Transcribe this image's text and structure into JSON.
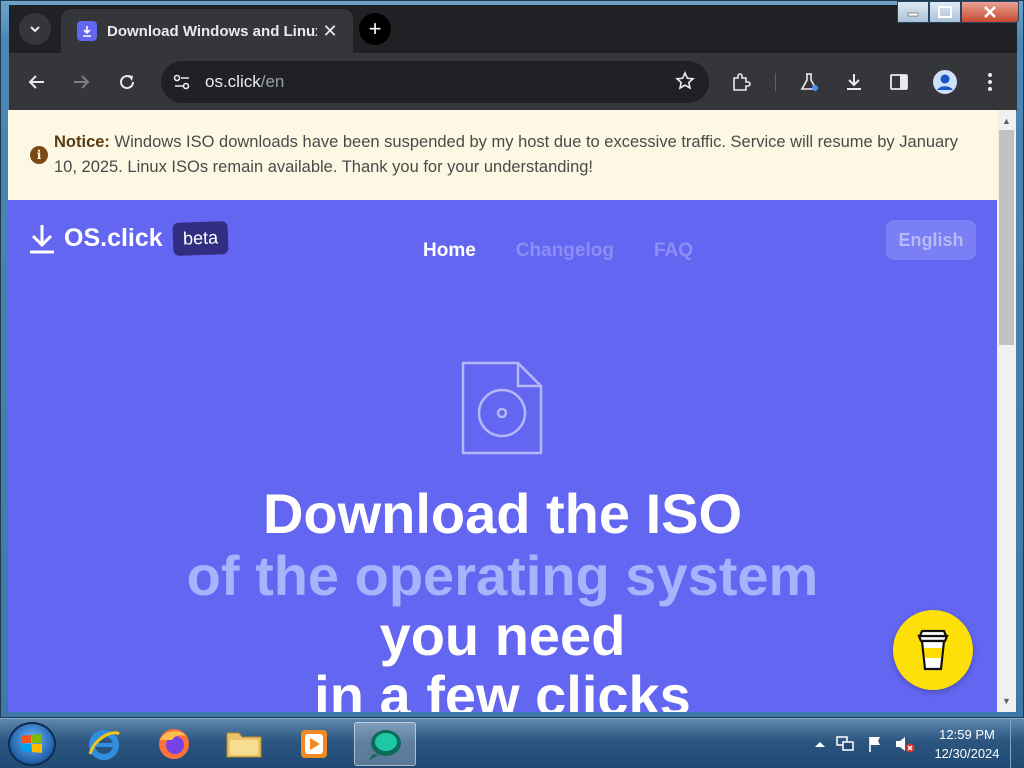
{
  "browser": {
    "tab_title": "Download Windows and Linux ISO",
    "url_host": "os.click",
    "url_path": "/en"
  },
  "notice": {
    "label": "Notice:",
    "text": "Windows ISO downloads have been suspended by my host due to excessive traffic. Service will resume by January 10, 2025. Linux ISOs remain available. Thank you for your understanding!"
  },
  "site": {
    "brand": "OS.click",
    "badge": "beta",
    "nav": [
      "Home",
      "Changelog",
      "FAQ"
    ],
    "language": "English"
  },
  "hero": {
    "line1": "Download the ISO",
    "line2": "of the operating system",
    "line3": "you need",
    "line4": "in a few clicks"
  },
  "taskbar": {
    "time": "12:59 PM",
    "date": "12/30/2024"
  },
  "colors": {
    "brand_bg": "#6366f1",
    "notice_bg": "#fdf8e3",
    "accent_text": "#a5b4fc",
    "coffee_button": "#fde007"
  },
  "icons": [
    "tab-search-icon",
    "download-favicon-icon",
    "close-tab-icon",
    "new-tab-icon",
    "back-icon",
    "forward-icon",
    "reload-icon",
    "site-settings-icon",
    "star-icon",
    "extensions-icon",
    "labs-icon",
    "downloads-icon",
    "side-panel-icon",
    "profile-icon",
    "menu-icon",
    "info-icon",
    "download-logo-icon",
    "disc-file-icon",
    "coffee-cup-icon"
  ]
}
